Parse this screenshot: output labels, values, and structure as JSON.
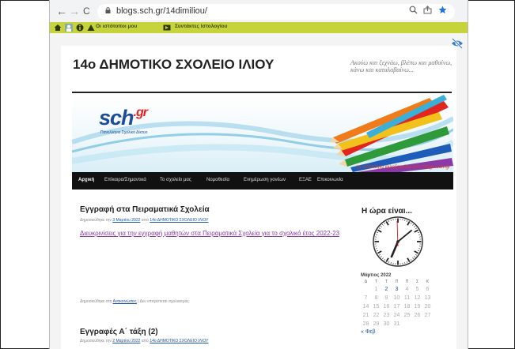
{
  "browser": {
    "url": "blogs.sch.gr/14dimiliou/",
    "back": "←",
    "forward": "→",
    "reload": "C"
  },
  "admin_bar": {
    "my_sites": "Οι ιστότοποι μου",
    "editor": "Συντάκτες Ιστολογίου"
  },
  "site": {
    "title": "14ο ΔΗΜΟΤΙΚΟ ΣΧΟΛΕΙΟ ΙΛΙΟΥ",
    "tagline": "Ακούω και ξεχνάω, βλέπω και μαθαίνω, κάνω και καταλαβαίνω..."
  },
  "banner": {
    "logo": "sch",
    "logo_suffix": ".gr",
    "logo_sub": "Πανελλήνιο Σχολικό Δίκτυο",
    "hosted_note": "το ιστολόγιο φιλοξενείται στο blogs.sch.gr"
  },
  "menu": {
    "items": [
      "Αρχική",
      "Επίκαιρα/Σημαντικά",
      "Το σχολείο μας",
      "Νομοθεσία",
      "Ενημέρωση γονέων",
      "ΕΞΑΕ",
      "Επικοινωνία"
    ]
  },
  "posts": [
    {
      "title": "Εγγραφή στα Πειραματικά Σχολεία",
      "meta_prefix": "Δημοσιεύθηκε την",
      "date": "3 Μαρτίου 2022",
      "meta_by": "από",
      "author": "14ο ΔΗΜΟΤΙΚΟ ΣΧΟΛΕΙΟ ΙΛΙΟΥ",
      "link_text": "Διευκρινίσεις για την εγγραφή μαθητών στα Πειραματικά Σχολεία για το σχολικό έτος 2022-23",
      "footer_prefix": "Δημοσιεύθηκε στη",
      "category": "Ανακοινώσεις",
      "footer_suffix": "| Δεν επιτρέπεται σχολιασμός"
    },
    {
      "title": "Εγγραφές Α΄ τάξη (2)",
      "meta_prefix": "Δημοσιεύθηκε την",
      "date": "2 Μαρτίου 2022",
      "meta_by": "από",
      "author": "14ο ΔΗΜΟΤΙΚΟ ΣΧΟΛΕΙΟ ΙΛΙΟΥ"
    }
  ],
  "sidebar": {
    "clock_title": "Η ώρα είναι...",
    "calendar": {
      "title": "Μάρτιος 2022",
      "headers": [
        "Δ",
        "Τ",
        "Τ",
        "Π",
        "Π",
        "Σ",
        "Κ"
      ],
      "prev": "« Φεβ"
    }
  },
  "colors": {
    "admin_bar": "#c7d33a",
    "menu": "#111111",
    "link": "#1a54a3",
    "visited_link": "#8a3aa8"
  }
}
